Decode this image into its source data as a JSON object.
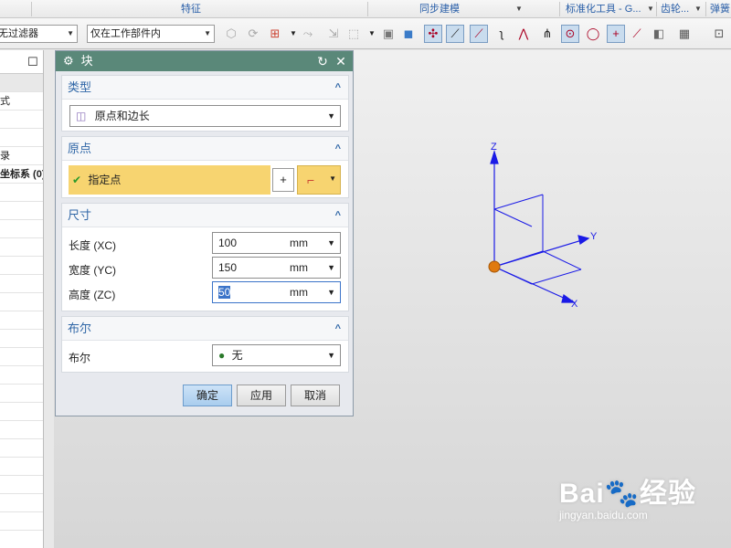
{
  "ribbon": {
    "groups": [
      "特征",
      "同步建模",
      "标准化工具 - G...",
      "齿轮...",
      "弹簧"
    ]
  },
  "toolbar": {
    "filter_label": "无过滤器",
    "scope_label": "仅在工作部件内"
  },
  "navigator": {
    "rows": [
      "",
      "式",
      "",
      "",
      "录",
      "坐标系 (0)"
    ]
  },
  "dialog": {
    "title": "块",
    "sections": {
      "type": {
        "header": "类型",
        "value": "原点和边长"
      },
      "origin": {
        "header": "原点",
        "specify_point": "指定点"
      },
      "dimensions": {
        "header": "尺寸",
        "length_label": "长度 (XC)",
        "length_value": "100",
        "width_label": "宽度 (YC)",
        "width_value": "150",
        "height_label": "高度 (ZC)",
        "height_value": "50",
        "unit": "mm"
      },
      "boolean": {
        "header": "布尔",
        "label": "布尔",
        "value": "无"
      }
    },
    "buttons": {
      "ok": "确定",
      "apply": "应用",
      "cancel": "取消"
    }
  },
  "viewport": {
    "axis_z": "Z",
    "axis_y": "Y",
    "axis_x": "X"
  },
  "watermark": {
    "brand": "Bai",
    "brand_suffix": "经验",
    "url": "jingyan.baidu.com"
  },
  "colors": {
    "dialog_title_bg": "#5a8879",
    "section_header": "#2f66a6",
    "highlight_row": "#f7d470",
    "axis_blue": "#1a1ae6",
    "origin_orange": "#e07a10"
  }
}
